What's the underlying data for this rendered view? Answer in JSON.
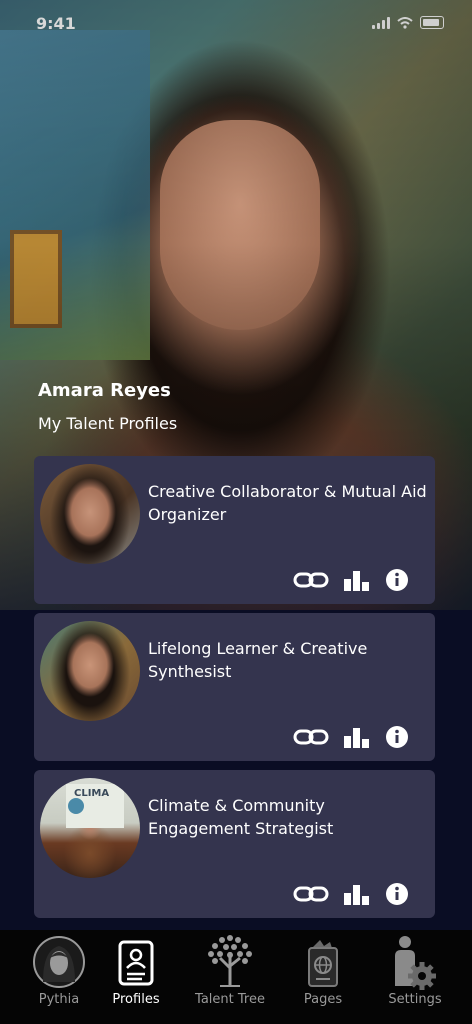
{
  "status_bar": {
    "time": "9:41"
  },
  "user": {
    "name": "Amara Reyes",
    "section_title": "My Talent Profiles"
  },
  "profiles": [
    {
      "title": "Creative Collaborator & Mutual Aid Organizer",
      "avatar": "portrait-woman-braid-icon",
      "actions": [
        "link-icon",
        "bar-chart-icon",
        "info-icon"
      ]
    },
    {
      "title": "Lifelong Learner & Creative Synthesist",
      "avatar": "portrait-woman-scarf-icon",
      "actions": [
        "link-icon",
        "bar-chart-icon",
        "info-icon"
      ]
    },
    {
      "title": "Climate & Community Engagement Strategist",
      "avatar": "presenter-climate-board-icon",
      "board_text": "CLIMA",
      "actions": [
        "link-icon",
        "bar-chart-icon",
        "info-icon"
      ]
    }
  ],
  "tabs": [
    {
      "label": "Pythia",
      "icon": "pythia-avatar-icon",
      "active": false
    },
    {
      "label": "Profiles",
      "icon": "profile-card-icon",
      "active": true
    },
    {
      "label": "Talent Tree",
      "icon": "tree-icon",
      "active": false
    },
    {
      "label": "Pages",
      "icon": "passport-icon",
      "active": false
    },
    {
      "label": "Settings",
      "icon": "person-gear-icon",
      "active": false
    }
  ],
  "colors": {
    "background": "#0a0d24",
    "card": "#34344e",
    "tabbar": "#050505",
    "tab_inactive": "#9a9a9a",
    "tab_active": "#ffffff"
  }
}
